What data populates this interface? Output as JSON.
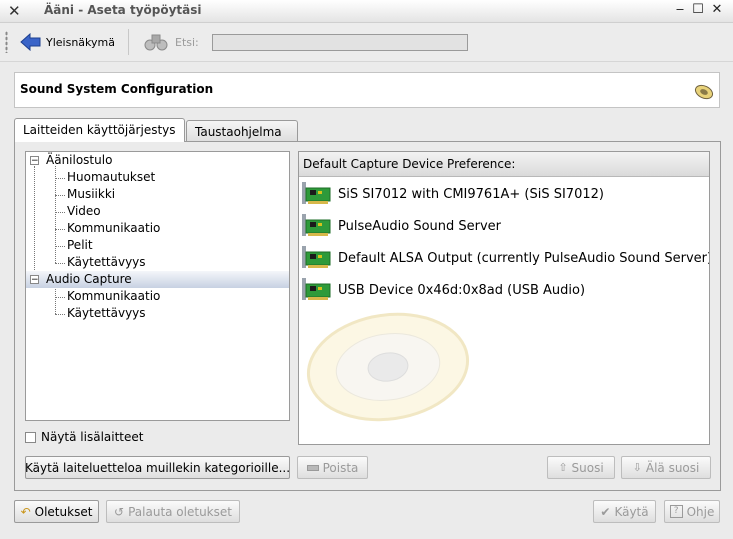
{
  "window": {
    "title": "Ääni - Aseta työpöytäsi",
    "controls": [
      "minimize",
      "maximize",
      "close"
    ]
  },
  "toolbar": {
    "back_label": "Yleisnäkymä",
    "search_label": "Etsi:",
    "search_value": ""
  },
  "module": {
    "title": "Sound System Configuration",
    "icon": "speaker-icon"
  },
  "tabs": [
    {
      "label": "Laitteiden käyttöjärjestys",
      "active": true
    },
    {
      "label": "Taustaohjelma",
      "active": false
    }
  ],
  "tree": {
    "categories": [
      {
        "label": "Äänilostulo",
        "children": [
          "Huomautukset",
          "Musiikki",
          "Video",
          "Kommunikaatio",
          "Pelit",
          "Käytettävyys"
        ]
      },
      {
        "label": "Audio Capture",
        "selected": true,
        "children": [
          "Kommunikaatio",
          "Käytettävyys"
        ]
      }
    ]
  },
  "show_advanced_label": "Näytä lisälaitteet",
  "apply_list_button": "Käytä laiteluetteloa muillekin kategorioille...",
  "remove_button": "Poista",
  "devices": {
    "header": "Default Capture Device Preference:",
    "items": [
      "SiS SI7012 with CMI9761A+ (SiS SI7012)",
      "PulseAudio Sound Server",
      "Default ALSA Output (currently PulseAudio Sound Server)",
      "USB Device 0x46d:0x8ad (USB Audio)"
    ]
  },
  "prefer_button": "Suosi",
  "defer_button": "Älä suosi",
  "footer": {
    "defaults": "Oletukset",
    "reset": "Palauta oletukset",
    "apply": "Käytä",
    "help": "Ohje"
  },
  "colors": {
    "window_bg": "#ebebeb",
    "selection": "#c7d1e2",
    "card_green": "#2e9a3a"
  }
}
